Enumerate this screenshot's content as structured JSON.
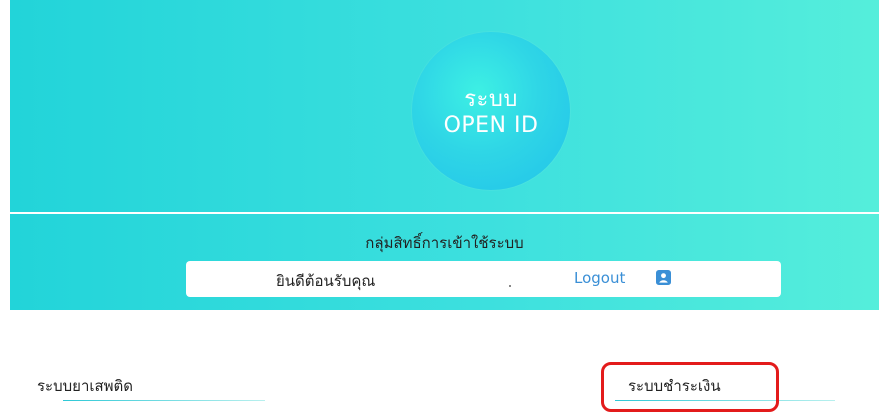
{
  "header": {
    "logo_line1": "ระบบ",
    "logo_line2": "OPEN ID",
    "group_title": "กลุ่มสิทธิ์การเข้าใช้ระบบ"
  },
  "user_bar": {
    "welcome": "ยินดีต้อนรับคุณ",
    "logout_label": "Logout",
    "icon": "user-icon"
  },
  "systems": [
    {
      "label": "ระบบยาเสพติด"
    },
    {
      "label": "ระบบชำระเงิน"
    }
  ],
  "colors": {
    "banner_start": "#22d4d9",
    "banner_end": "#55eedb",
    "link": "#3a8fd6",
    "highlight": "#e31b1b"
  }
}
